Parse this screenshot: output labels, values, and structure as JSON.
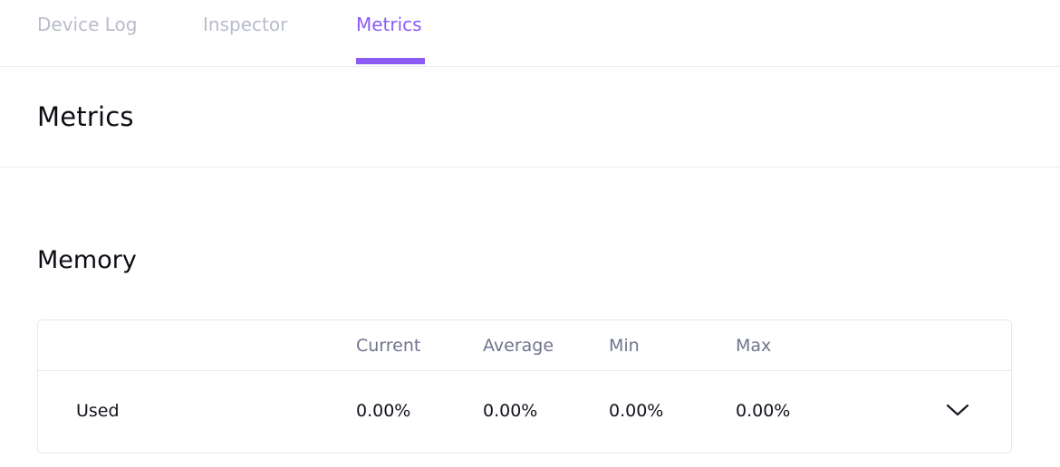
{
  "tabs": [
    {
      "label": "Device Log",
      "active": false
    },
    {
      "label": "Inspector",
      "active": false
    },
    {
      "label": "Metrics",
      "active": true
    }
  ],
  "accent_color": "#8b5cf6",
  "page": {
    "title": "Metrics"
  },
  "memory": {
    "section_title": "Memory",
    "columns": [
      "Current",
      "Average",
      "Min",
      "Max"
    ],
    "rows": [
      {
        "label": "Used",
        "values": [
          "0.00%",
          "0.00%",
          "0.00%",
          "0.00%"
        ],
        "expand_icon": "chevron-down-icon"
      }
    ]
  }
}
